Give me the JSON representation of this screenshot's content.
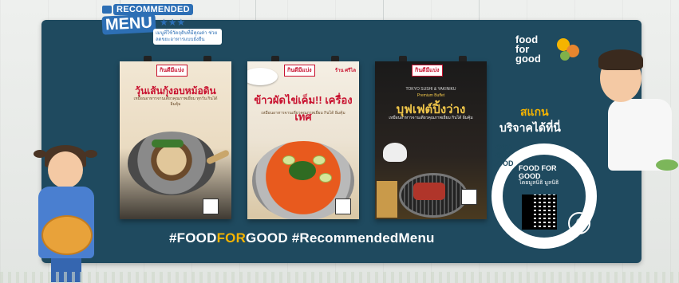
{
  "badge": {
    "recommended": "RECOMMENDED",
    "menu": "MENU",
    "stars": "★★★",
    "subtext": "เมนูที่ใช้วัตถุดิบที่มีคุณค่า ช่วยลดขยะอาหารแบบยั่งยืน"
  },
  "posters": [
    {
      "tag": "กินดีมีแบ่ง",
      "title": "วุ้นเส้นกุ้งอบหม้อดิน",
      "small": "เหมือนอาหารจานเดียวคุณภาพเยี่ยม ทุกวัน กินได้ อิ่มคุ้ม"
    },
    {
      "tag": "กินดีมีแบ่ง",
      "label": "ร้าน ศรีไล",
      "title": "ข้าวผัดไข่เค็ม!! เครื่องเทศ",
      "small": "เหมือนอาหารจานเดียวคุณภาพเยี่ยม กินได้ อิ่มคุ้ม"
    },
    {
      "tag": "กินดีมีแบ่ง",
      "brand_en": "TOKYO SUSHI & YAKINIKU",
      "brand_sub": "Premium Buffet",
      "title": "บุฟเฟต์ปิ้งว่าง",
      "small": "เหมือนอาหารจานเดียวคุณภาพเยี่ยม กินได้ อิ่มคุ้ม"
    }
  ],
  "hashtag": {
    "part1": "#FOOD",
    "part2": "FOR",
    "part3": "GOOD",
    "part4": " #RecommendedMenu"
  },
  "logo": {
    "line1": "food",
    "line2": "for",
    "line3": "good"
  },
  "scan": {
    "line1": "สแกน",
    "line2": "บริจาคได้ที่นี่"
  },
  "donation": {
    "name_en": "FOOD FOR GOOD",
    "name_th": "โดยมูลนิธิ มูลนิธิ"
  },
  "colors": {
    "board": "#1f4a5f",
    "accent_gold": "#f5b400",
    "brand_blue": "#2d6fb5"
  }
}
